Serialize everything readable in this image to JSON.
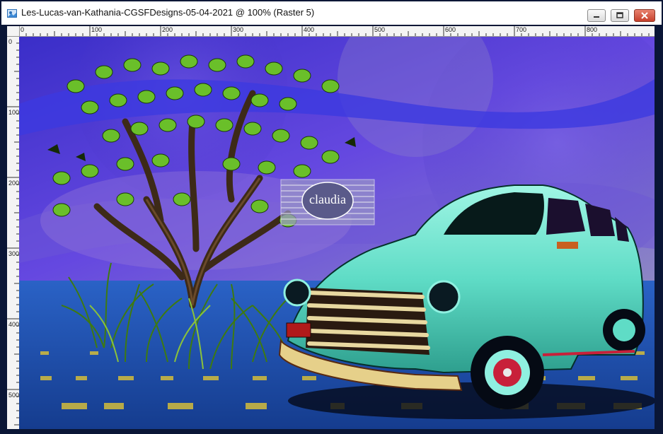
{
  "window": {
    "title": "Les-Lucas-van-Kathania-CGSFDesigns-05-04-2021 @ 100% (Raster 5)"
  },
  "controls": {
    "minimize_icon": "minimize-icon",
    "maximize_icon": "restore-icon",
    "close_icon": "close-icon"
  },
  "ruler": {
    "top_labels": [
      "0",
      "100",
      "200",
      "300",
      "400",
      "500",
      "600",
      "700",
      "800"
    ],
    "left_labels": [
      "0",
      "100",
      "200",
      "300",
      "400",
      "500"
    ]
  },
  "artwork": {
    "watermark_text": "claudia",
    "colors": {
      "sky": "#5a3fd8",
      "floor": "#1f4fa8",
      "car": "#66e6cc",
      "tree": "#6abf2a"
    }
  }
}
